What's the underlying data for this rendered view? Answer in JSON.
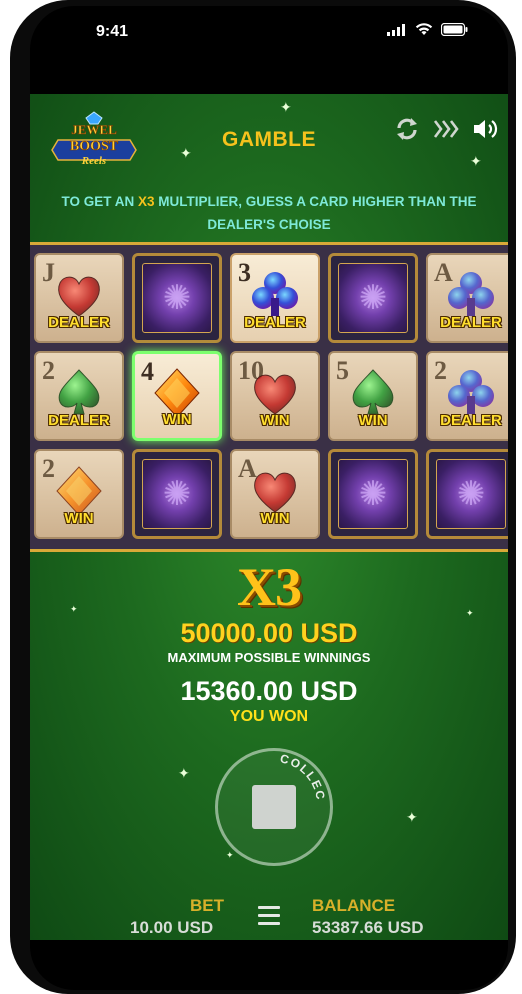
{
  "status_bar": {
    "time": "9:41"
  },
  "header": {
    "logo_text": [
      "JEWEL",
      "BOOST",
      "Reels"
    ],
    "title": "GAMBLE"
  },
  "instruction": {
    "part1": "TO GET AN ",
    "highlight": "X3",
    "part2": " MULTIPLIER, GUESS A CARD HIGHER THAN THE DEALER'S CHOISE"
  },
  "grid": {
    "rows": [
      [
        {
          "type": "card",
          "rank": "J",
          "suit": "heart",
          "label": "DEALER",
          "state": "dim"
        },
        {
          "type": "back"
        },
        {
          "type": "card",
          "rank": "3",
          "suit": "club",
          "label": "DEALER",
          "state": "up"
        },
        {
          "type": "back"
        },
        {
          "type": "card",
          "rank": "A",
          "suit": "club",
          "label": "DEALER",
          "state": "dim"
        }
      ],
      [
        {
          "type": "card",
          "rank": "2",
          "suit": "spade",
          "label": "DEALER",
          "state": "dim"
        },
        {
          "type": "card",
          "rank": "4",
          "suit": "diamond",
          "label": "WIN",
          "state": "selected"
        },
        {
          "type": "card",
          "rank": "10",
          "suit": "heart",
          "label": "WIN",
          "state": "dim"
        },
        {
          "type": "card",
          "rank": "5",
          "suit": "spade",
          "label": "WIN",
          "state": "dim"
        },
        {
          "type": "card",
          "rank": "2",
          "suit": "club",
          "label": "DEALER",
          "state": "dim"
        }
      ],
      [
        {
          "type": "card",
          "rank": "2",
          "suit": "diamond",
          "label": "WIN",
          "state": "dim"
        },
        {
          "type": "back"
        },
        {
          "type": "card",
          "rank": "A",
          "suit": "heart",
          "label": "WIN",
          "state": "dim"
        },
        {
          "type": "back"
        },
        {
          "type": "back"
        }
      ]
    ]
  },
  "multiplier": "X3",
  "max_win": {
    "amount": "50000.00 USD",
    "label": "MAXIMUM POSSIBLE WINNINGS"
  },
  "won": {
    "amount": "15360.00 USD",
    "label": "YOU WON"
  },
  "collect": {
    "label": "COLLECT"
  },
  "footer": {
    "bet_label": "BET",
    "bet_value": "10.00 USD",
    "balance_label": "BALANCE",
    "balance_value": "53387.66 USD"
  },
  "colors": {
    "accent": "#f5c21d",
    "instruction": "#7ee9d8",
    "win_label": "#ffde2e",
    "felt": "#1d6a1f"
  }
}
